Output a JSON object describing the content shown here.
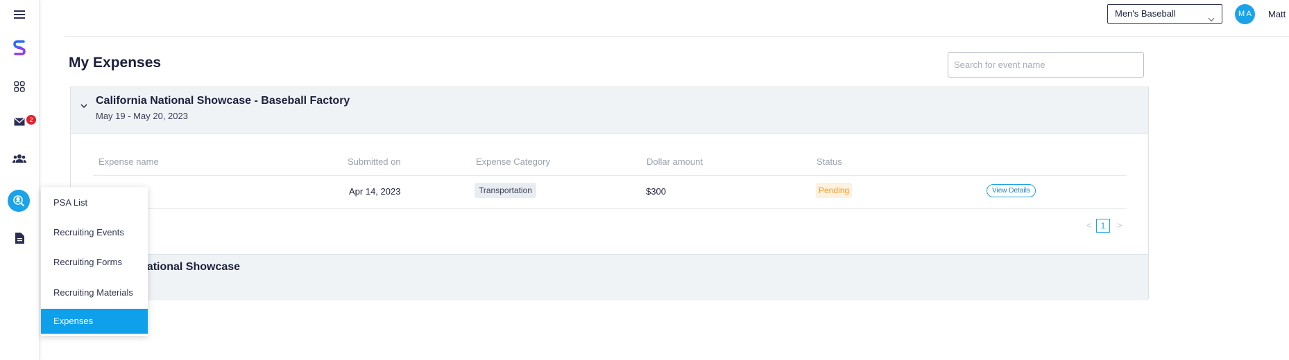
{
  "header": {
    "team_select": "Men's Baseball",
    "avatar_initials": "M A",
    "username": "Matt"
  },
  "sidebar": {
    "messages_badge": "2"
  },
  "page": {
    "title": "My Expenses",
    "search_placeholder": "Search for event name"
  },
  "events": [
    {
      "title": "California National Showcase - Baseball Factory",
      "dates": "May 19 - May 20, 2023",
      "table": {
        "columns": [
          "Expense name",
          "Submitted on",
          "Expense Category",
          "Dollar amount",
          "Status"
        ],
        "rows": [
          {
            "submitted_on": "Apr 14, 2023",
            "category": "Transportation",
            "amount": "$300",
            "status": "Pending",
            "action": "View Details"
          }
        ]
      },
      "pagination": {
        "prev": "<",
        "current": "1",
        "next": ">"
      }
    },
    {
      "title": "Factory National Showcase"
    }
  ],
  "menu": {
    "items": [
      "PSA List",
      "Recruiting Events",
      "Recruiting Forms",
      "Recruiting Materials",
      "Expenses"
    ],
    "active": "Expenses"
  },
  "colors": {
    "accent": "#1aa3e8",
    "menu_active": "#0fa0ec",
    "pending": "#f29d2c",
    "badge": "#e8202a"
  }
}
